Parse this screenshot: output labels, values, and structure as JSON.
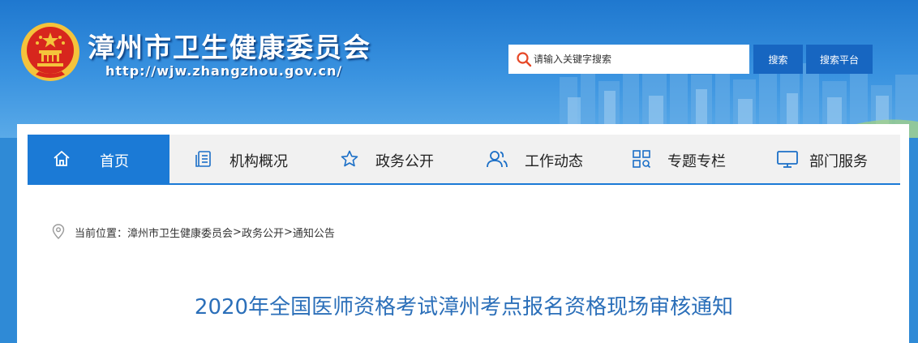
{
  "site": {
    "title": "漳州市卫生健康委员会",
    "url": "http://wjw.zhangzhou.gov.cn/"
  },
  "search": {
    "placeholder": "请输入关键字搜索",
    "button_label": "搜索",
    "platform_label": "搜索平台"
  },
  "nav": [
    {
      "label": "首页",
      "icon": "home-icon",
      "active": true
    },
    {
      "label": "机构概况",
      "icon": "document-list-icon"
    },
    {
      "label": "政务公开",
      "icon": "star-icon"
    },
    {
      "label": "工作动态",
      "icon": "users-icon"
    },
    {
      "label": "专题专栏",
      "icon": "grid-search-icon"
    },
    {
      "label": "部门服务",
      "icon": "monitor-icon"
    }
  ],
  "breadcrumb": {
    "prefix": "当前位置：",
    "items": [
      "漳州市卫生健康委员会",
      "政务公开",
      "通知公告"
    ],
    "separator": ">"
  },
  "article": {
    "title": "2020年全国医师资格考试漳州考点报名资格现场审核通知"
  },
  "colors": {
    "primary_blue": "#1b7ad6",
    "button_blue": "#1766c1",
    "title_blue": "#2b6fb9",
    "emblem_red": "#d7261d",
    "emblem_gold": "#f4c33b"
  }
}
